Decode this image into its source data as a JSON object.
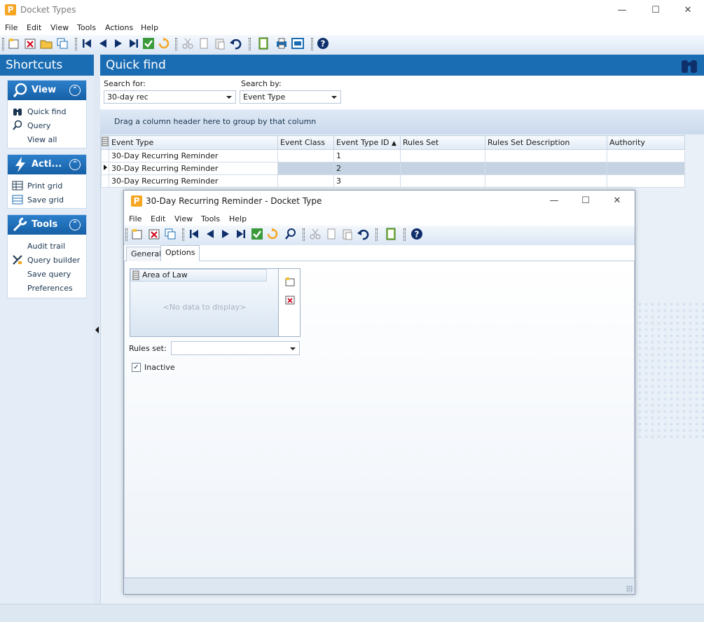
{
  "window": {
    "title": "Docket Types",
    "logo_letter": "P",
    "minimize": "—",
    "maximize": "☐",
    "close": "✕"
  },
  "menu": [
    "File",
    "Edit",
    "View",
    "Tools",
    "Actions",
    "Help"
  ],
  "sidebar": {
    "title": "Shortcuts",
    "panels": [
      {
        "title": "View",
        "items": [
          "Quick find",
          "Query",
          "View all"
        ]
      },
      {
        "title": "Acti...",
        "items": [
          "Print grid",
          "Save grid"
        ]
      },
      {
        "title": "Tools",
        "items": [
          "Audit trail",
          "Query builder",
          "Save query",
          "Preferences"
        ]
      }
    ]
  },
  "quick_find": {
    "title": "Quick find",
    "search_for_label": "Search for:",
    "search_for_value": "30-day rec",
    "search_by_label": "Search by:",
    "search_by_value": "Event Type",
    "group_hint": "Drag a column header here to group by that column"
  },
  "grid": {
    "columns": [
      "Event Type",
      "Event Class",
      "Event Type ID",
      "Rules Set",
      "Rules Set Description",
      "Authority"
    ],
    "sorted_column": "Event Type ID",
    "sort_indicator": "▲",
    "rows": [
      {
        "event_type": "30-Day Recurring Reminder",
        "event_class": "",
        "id": "1",
        "rules_set": "",
        "rules_desc": "",
        "authority": ""
      },
      {
        "event_type": "30-Day Recurring Reminder",
        "event_class": "",
        "id": "2",
        "rules_set": "",
        "rules_desc": "",
        "authority": ""
      },
      {
        "event_type": "30-Day Recurring Reminder",
        "event_class": "",
        "id": "3",
        "rules_set": "",
        "rules_desc": "",
        "authority": ""
      }
    ],
    "selected_row": 1
  },
  "dialog": {
    "title": "30-Day Recurring Reminder - Docket Type",
    "menu": [
      "File",
      "Edit",
      "View",
      "Tools",
      "Help"
    ],
    "tabs": [
      "General",
      "Options"
    ],
    "active_tab": "Options",
    "area_of_law_header": "Area of Law",
    "no_data": "<No data to display>",
    "rules_set_label": "Rules set:",
    "rules_set_value": "",
    "inactive_label": "Inactive",
    "inactive_checked": true
  },
  "colors": {
    "header_blue": "#1b6db3",
    "panel_bg": "#e4edf7",
    "accent_orange": "#f5a623",
    "confirm_green": "#3a9a3a"
  }
}
